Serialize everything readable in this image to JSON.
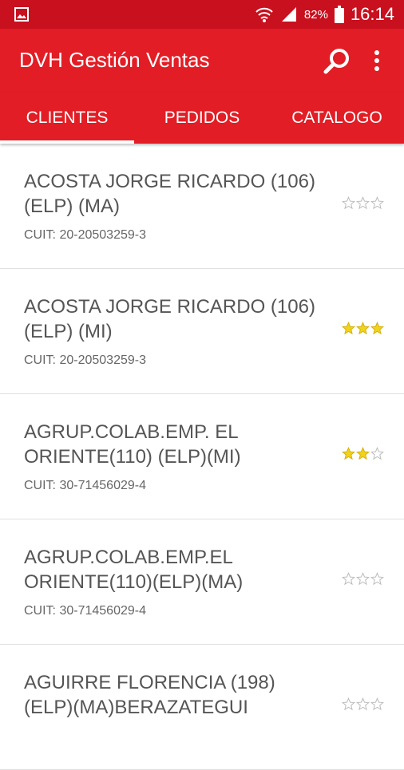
{
  "status_bar": {
    "battery": "82%",
    "time": "16:14",
    "icons": [
      "gallery-icon",
      "wifi-icon",
      "signal-icon",
      "battery-icon"
    ]
  },
  "app_bar": {
    "title": "DVH Gestión Ventas",
    "icons": [
      "search-icon",
      "more-vert-icon"
    ]
  },
  "tabs": [
    {
      "label": "CLIENTES",
      "selected": true
    },
    {
      "label": "PEDIDOS",
      "selected": false
    },
    {
      "label": "CATALOGO",
      "selected": false
    }
  ],
  "clients": [
    {
      "name": "ACOSTA JORGE RICARDO (106) (ELP) (MA)",
      "cuit": "CUIT: 20-20503259-3",
      "rating": 0,
      "max_rating": 3
    },
    {
      "name": "ACOSTA JORGE RICARDO (106) (ELP) (MI)",
      "cuit": "CUIT: 20-20503259-3",
      "rating": 3,
      "max_rating": 3
    },
    {
      "name": "AGRUP.COLAB.EMP. EL ORIENTE(110) (ELP)(MI)",
      "cuit": "CUIT: 30-71456029-4",
      "rating": 2,
      "max_rating": 3
    },
    {
      "name": "AGRUP.COLAB.EMP.EL ORIENTE(110)(ELP)(MA)",
      "cuit": "CUIT: 30-71456029-4",
      "rating": 0,
      "max_rating": 3
    },
    {
      "name": "AGUIRRE FLORENCIA (198) (ELP)(MA)BERAZATEGUI",
      "cuit": "",
      "rating": 0,
      "max_rating": 3
    }
  ],
  "colors": {
    "status_bar": "#c8101e",
    "app_bar": "#e21d25",
    "star_filled": "#f2d31b",
    "star_empty": "#bdbdbd"
  }
}
